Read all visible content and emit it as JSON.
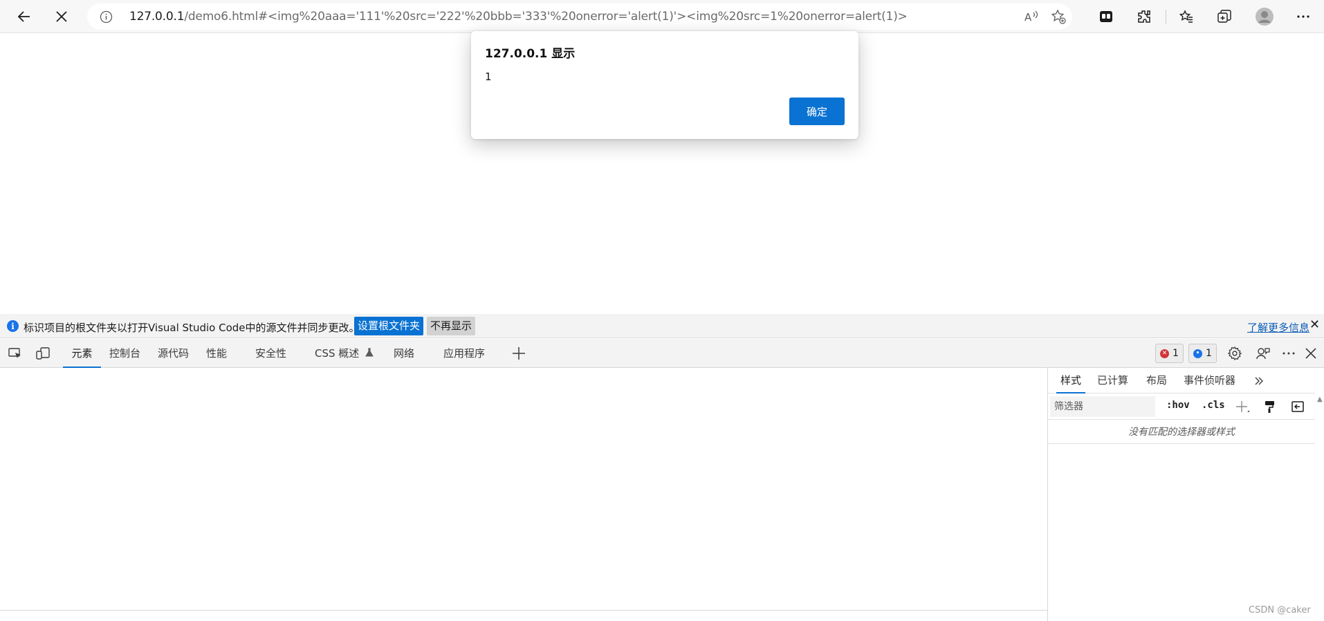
{
  "browser": {
    "url_host": "127.0.0.1",
    "url_rest": "/demo6.html#<img%20aaa='111'%20src='222'%20bbb='333'%20onerror='alert(1)'><img%20src=1%20onerror=alert(1)>"
  },
  "dialog": {
    "title": "127.0.0.1 显示",
    "message": "1",
    "ok_label": "确定"
  },
  "infobar": {
    "text": "标识项目的根文件夹以打开Visual Studio Code中的源文件并同步更改。",
    "set_root_button": "设置根文件夹",
    "dont_show_button": "不再显示",
    "learn_more_link": "了解更多信息",
    "close": "✕"
  },
  "devtools": {
    "tabs": [
      "元素",
      "控制台",
      "源代码",
      "性能",
      "安全性",
      "CSS 概述",
      "网络",
      "应用程序"
    ],
    "errors_count": "1",
    "messages_count": "1"
  },
  "styles_panel": {
    "tabs": [
      "样式",
      "已计算",
      "布局",
      "事件侦听器"
    ],
    "filter_placeholder": "筛选器",
    "hov_label": ":hov",
    "cls_label": ".cls",
    "empty_message": "没有匹配的选择器或样式"
  },
  "watermark": "CSDN @caker",
  "colors": {
    "accent": "#0a72d2",
    "toolbar_bg": "#f7f7f7",
    "devtools_bg": "#f3f3f3",
    "error_red": "#d13438",
    "message_blue": "#1a73e8"
  }
}
